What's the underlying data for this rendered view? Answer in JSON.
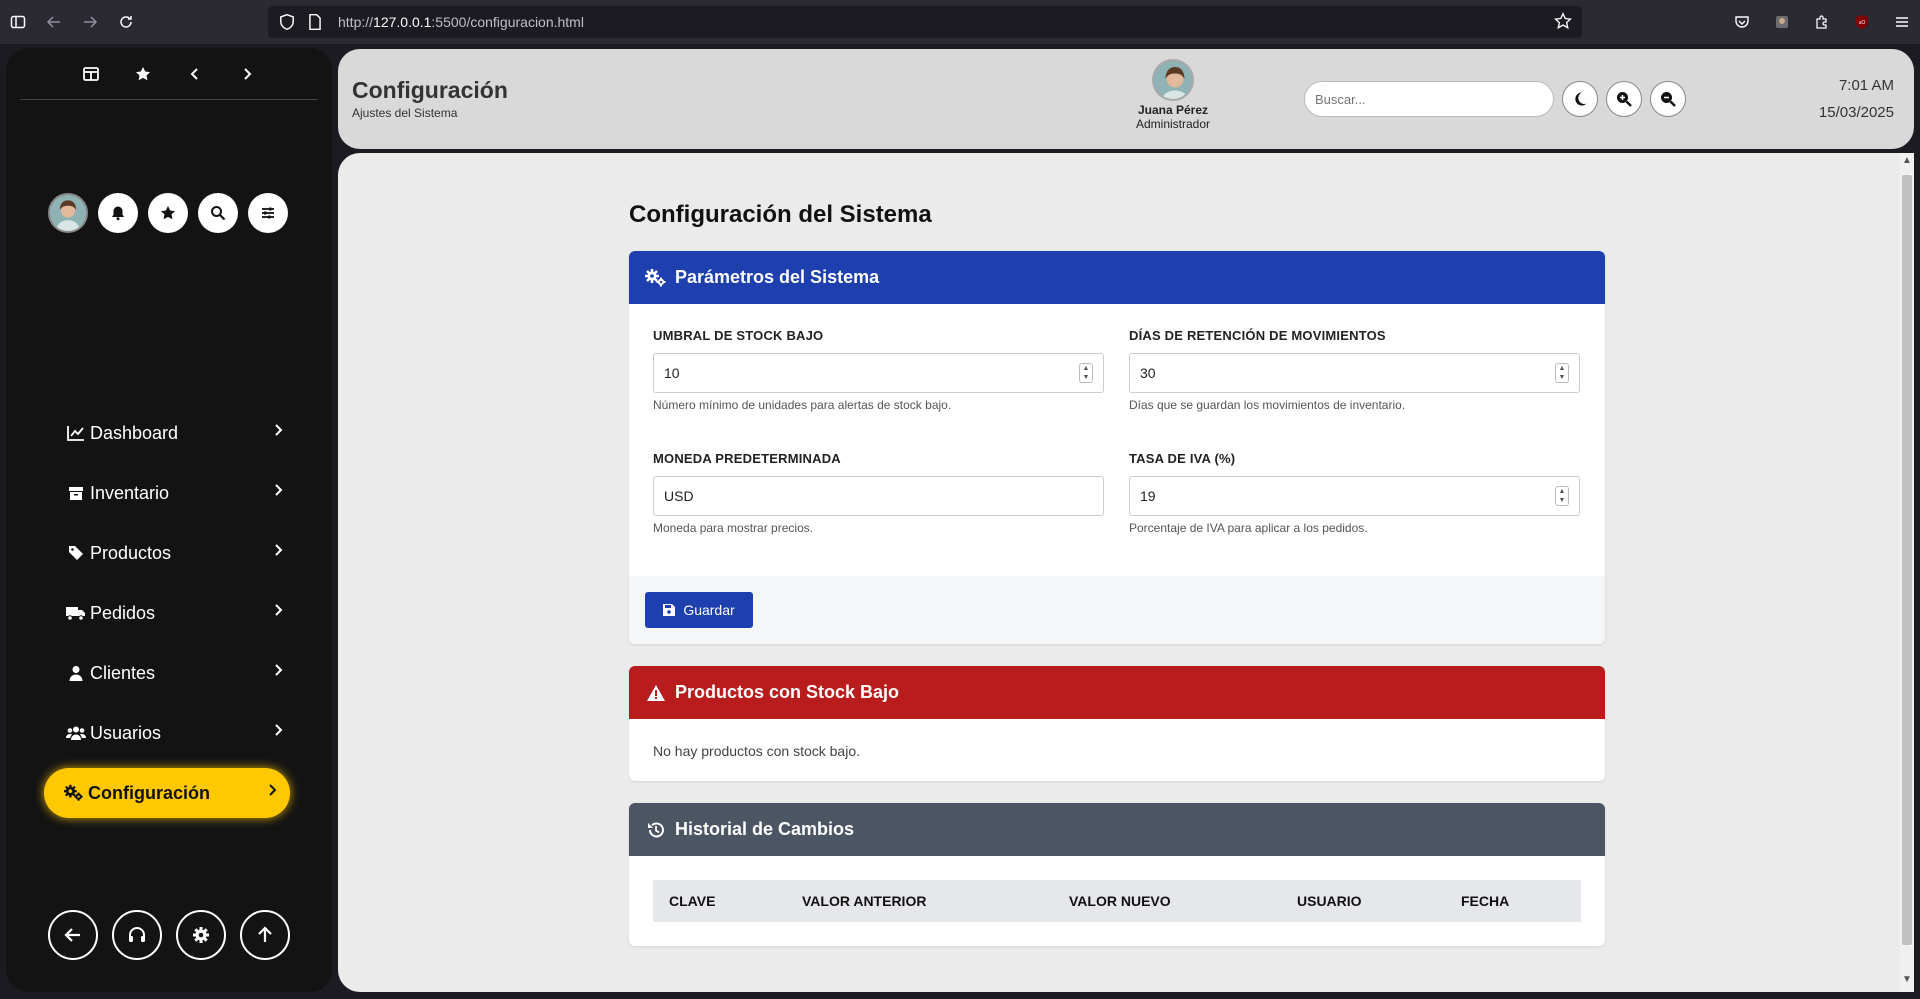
{
  "browser": {
    "url_prefix": "http://",
    "url_host": "127.0.0.1",
    "url_rest": ":5500/configuracion.html"
  },
  "sidebar": {
    "nav": [
      {
        "label": "Dashboard",
        "icon": "chart-line-icon"
      },
      {
        "label": "Inventario",
        "icon": "box-icon"
      },
      {
        "label": "Productos",
        "icon": "tag-icon"
      },
      {
        "label": "Pedidos",
        "icon": "truck-icon"
      },
      {
        "label": "Clientes",
        "icon": "user-icon"
      },
      {
        "label": "Usuarios",
        "icon": "users-icon"
      },
      {
        "label": "Configuración",
        "icon": "gears-icon",
        "active": true
      }
    ]
  },
  "header": {
    "title": "Configuración",
    "subtitle": "Ajustes del Sistema",
    "user_name": "Juana Pérez",
    "user_role": "Administrador",
    "search_placeholder": "Buscar...",
    "time": "7:01 AM",
    "date": "15/03/2025"
  },
  "main": {
    "page_title": "Configuración del Sistema",
    "params_card": {
      "title": "Parámetros del Sistema",
      "fields": {
        "stock_threshold": {
          "label": "UMBRAL DE STOCK BAJO",
          "value": "10",
          "help": "Número mínimo de unidades para alertas de stock bajo."
        },
        "retention_days": {
          "label": "DÍAS DE RETENCIÓN DE MOVIMIENTOS",
          "value": "30",
          "help": "Días que se guardan los movimientos de inventario."
        },
        "currency": {
          "label": "MONEDA PREDETERMINADA",
          "value": "USD",
          "help": "Moneda para mostrar precios."
        },
        "iva_rate": {
          "label": "TASA DE IVA (%)",
          "value": "19",
          "help": "Porcentaje de IVA para aplicar a los pedidos."
        }
      },
      "save_label": "Guardar"
    },
    "low_stock_card": {
      "title": "Productos con Stock Bajo",
      "empty_message": "No hay productos con stock bajo."
    },
    "history_card": {
      "title": "Historial de Cambios",
      "columns": [
        "CLAVE",
        "VALOR ANTERIOR",
        "VALOR NUEVO",
        "USUARIO",
        "FECHA"
      ]
    }
  },
  "colors": {
    "primary": "#1e40af",
    "danger": "#b91c1c",
    "neutral": "#4b5563",
    "accent": "#ffc800",
    "sidebar_bg": "#131313"
  }
}
